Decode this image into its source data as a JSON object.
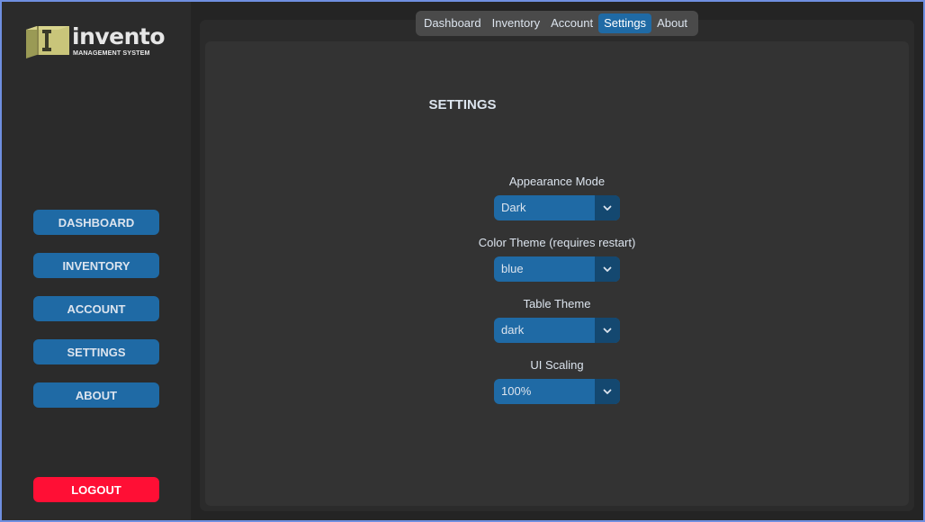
{
  "logo": {
    "word": "invento",
    "subtitle": "MANAGEMENT SYSTEM"
  },
  "sidebar": {
    "items": [
      {
        "label": "DASHBOARD"
      },
      {
        "label": "INVENTORY"
      },
      {
        "label": "ACCOUNT"
      },
      {
        "label": "SETTINGS"
      },
      {
        "label": "ABOUT"
      }
    ],
    "logout_label": "LOGOUT"
  },
  "tabs": [
    {
      "label": "Dashboard"
    },
    {
      "label": "Inventory"
    },
    {
      "label": "Account"
    },
    {
      "label": "Settings",
      "active": true
    },
    {
      "label": "About"
    }
  ],
  "settings": {
    "title": "SETTINGS",
    "appearance": {
      "label": "Appearance Mode",
      "value": "Dark"
    },
    "color_theme": {
      "label": "Color Theme (requires restart)",
      "value": "blue"
    },
    "table_theme": {
      "label": "Table Theme",
      "value": "dark"
    },
    "ui_scaling": {
      "label": "UI Scaling",
      "value": "100%"
    }
  },
  "colors": {
    "accent": "#1f6aa5",
    "accent_dark": "#144870",
    "logout": "#ff0f35",
    "background": "#242424",
    "panel": "#2b2b2b",
    "content": "#333333"
  },
  "icons": {
    "logo": "invento-box-logo",
    "dropdown": "chevron-down-icon"
  }
}
